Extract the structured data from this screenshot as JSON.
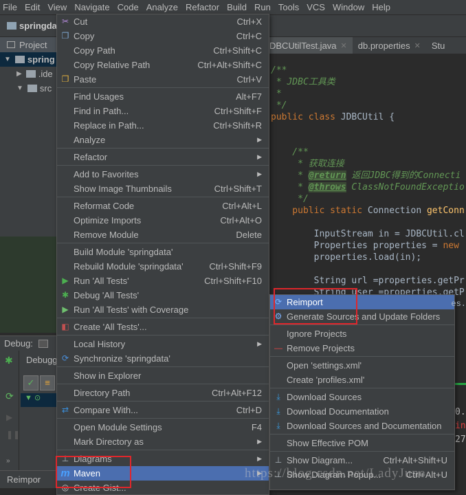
{
  "menubar": [
    "File",
    "Edit",
    "View",
    "Navigate",
    "Code",
    "Analyze",
    "Refactor",
    "Build",
    "Run",
    "Tools",
    "VCS",
    "Window",
    "Help"
  ],
  "navbar": {
    "project": "springda"
  },
  "project_panel": {
    "tab": "Project",
    "tree": [
      {
        "label": "spring",
        "indent": 0,
        "expanded": true
      },
      {
        "label": ".ide",
        "indent": 1,
        "expanded": false
      },
      {
        "label": "src",
        "indent": 1,
        "expanded": true
      }
    ]
  },
  "editor": {
    "tabs": [
      {
        "label": "DBCUtilTest.java"
      },
      {
        "label": "db.properties"
      },
      {
        "label": "Stu"
      }
    ],
    "code": {
      "l1": "/**",
      "l2": " * JDBC工具类",
      "l3": " *",
      "l4": " */",
      "l5a": "public class ",
      "l5b": "JDBCUtil {",
      "l6": "    /**",
      "l7": "     * 获取连接",
      "l8a": "     * ",
      "l8b": "@return",
      " l8c": "",
      "l8c": " 返回JDBC得到的Connecti",
      "l9a": "     * ",
      "l9b": "@throws",
      "l9c": " ClassNotFoundExceptio",
      "l10": "     */",
      "l11a": "    public static ",
      "l11b": "Connection ",
      "l11c": "getConn",
      "l12": "        InputStream in = JDBCUtil.cl",
      "l13a": "        Properties properties = ",
      "l13b": "new",
      "l14": "        properties.load(in);",
      "l15": "        String url =properties.getPr",
      "l16": "        String user =properties.getP",
      "l17": "                               es.",
      "l18": "                               ort"
    }
  },
  "debug": {
    "label": "Debug:",
    "tab": "Debugge",
    "status": "Reimpor"
  },
  "console": {
    "l1": "0.",
    "l2": "in",
    "l3": "27"
  },
  "context_menu": {
    "groups": [
      [
        {
          "label": "Cut",
          "shortcut": "Ctrl+X",
          "icon": "scissors-icon"
        },
        {
          "label": "Copy",
          "shortcut": "Ctrl+C",
          "icon": "copy-icon"
        },
        {
          "label": "Copy Path",
          "shortcut": "Ctrl+Shift+C"
        },
        {
          "label": "Copy Relative Path",
          "shortcut": "Ctrl+Alt+Shift+C"
        },
        {
          "label": "Paste",
          "shortcut": "Ctrl+V",
          "icon": "paste-icon"
        }
      ],
      [
        {
          "label": "Find Usages",
          "shortcut": "Alt+F7"
        },
        {
          "label": "Find in Path...",
          "shortcut": "Ctrl+Shift+F"
        },
        {
          "label": "Replace in Path...",
          "shortcut": "Ctrl+Shift+R"
        },
        {
          "label": "Analyze",
          "submenu": true
        }
      ],
      [
        {
          "label": "Refactor",
          "submenu": true
        }
      ],
      [
        {
          "label": "Add to Favorites",
          "submenu": true
        },
        {
          "label": "Show Image Thumbnails",
          "shortcut": "Ctrl+Shift+T"
        }
      ],
      [
        {
          "label": "Reformat Code",
          "shortcut": "Ctrl+Alt+L"
        },
        {
          "label": "Optimize Imports",
          "shortcut": "Ctrl+Alt+O"
        },
        {
          "label": "Remove Module",
          "shortcut": "Delete"
        }
      ],
      [
        {
          "label": "Build Module 'springdata'"
        },
        {
          "label": "Rebuild Module 'springdata'",
          "shortcut": "Ctrl+Shift+F9"
        },
        {
          "label": "Run 'All Tests'",
          "shortcut": "Ctrl+Shift+F10",
          "icon": "run-icon"
        },
        {
          "label": "Debug 'All Tests'",
          "icon": "debug-icon"
        },
        {
          "label": "Run 'All Tests' with Coverage",
          "icon": "coverage-icon"
        }
      ],
      [
        {
          "label": "Create 'All Tests'...",
          "icon": "test-config-icon"
        }
      ],
      [
        {
          "label": "Local History",
          "submenu": true
        },
        {
          "label": "Synchronize 'springdata'",
          "icon": "sync-icon"
        }
      ],
      [
        {
          "label": "Show in Explorer"
        }
      ],
      [
        {
          "label": "Directory Path",
          "shortcut": "Ctrl+Alt+F12"
        }
      ],
      [
        {
          "label": "Compare With...",
          "shortcut": "Ctrl+D",
          "icon": "compare-icon"
        }
      ],
      [
        {
          "label": "Open Module Settings",
          "shortcut": "F4"
        },
        {
          "label": "Mark Directory as",
          "submenu": true
        }
      ],
      [
        {
          "label": "Diagrams",
          "submenu": true,
          "icon": "diagram-icon"
        },
        {
          "label": "Maven",
          "submenu": true,
          "icon": "maven-icon",
          "selected": true
        },
        {
          "label": "Create Gist...",
          "icon": "gist-icon"
        }
      ]
    ]
  },
  "maven_submenu": {
    "groups": [
      [
        {
          "label": "Reimport",
          "icon": "reimport-icon",
          "selected": true
        },
        {
          "label": "Generate Sources and Update Folders",
          "icon": "generate-icon"
        }
      ],
      [
        {
          "label": "Ignore Projects"
        },
        {
          "label": "Remove Projects",
          "icon": "minus-icon"
        }
      ],
      [
        {
          "label": "Open 'settings.xml'"
        },
        {
          "label": "Create 'profiles.xml'"
        }
      ],
      [
        {
          "label": "Download Sources",
          "icon": "download-icon"
        },
        {
          "label": "Download Documentation",
          "icon": "download-icon"
        },
        {
          "label": "Download Sources and Documentation",
          "icon": "download-icon"
        }
      ],
      [
        {
          "label": "Show Effective POM"
        }
      ],
      [
        {
          "label": "Show Diagram...",
          "shortcut": "Ctrl+Alt+Shift+U",
          "icon": "diagram-icon"
        },
        {
          "label": "Show Diagram Popup...",
          "shortcut": "Ctrl+Alt+U",
          "icon": "diagram-icon"
        }
      ]
    ]
  },
  "watermark": "https://blog.csdn.net/LadyJune",
  "colors": {
    "selection": "#4b6eaf",
    "highlight_box": "#e0262b",
    "menu_bg": "#3c3f41",
    "editor_bg": "#2b2b2b"
  }
}
